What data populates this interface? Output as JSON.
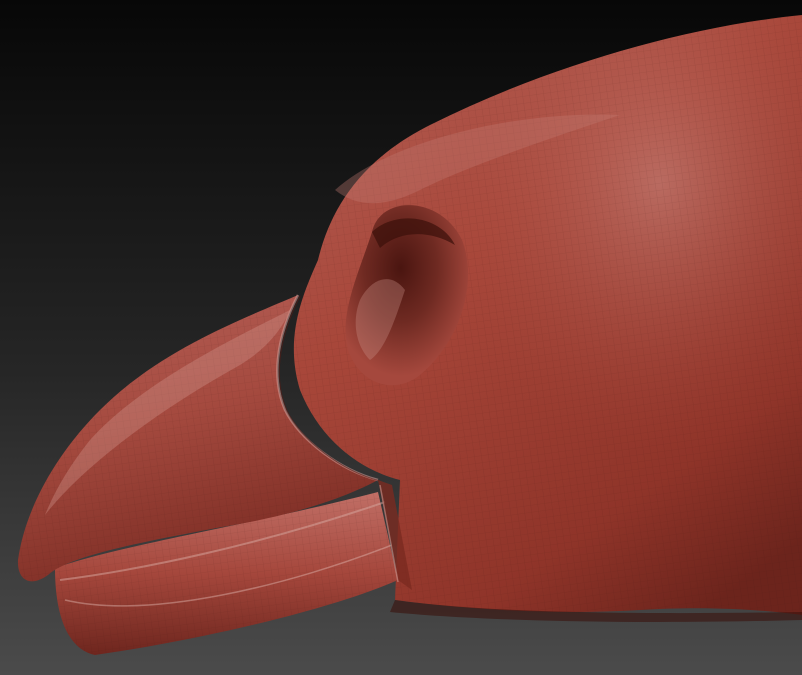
{
  "viewport": {
    "subject": "sculpted-bird-head-icon",
    "material_color": "#a8473a",
    "material_highlight": "#c98f88",
    "material_shadow": "#5a1d16",
    "background_top": "#070707",
    "background_bottom": "#4b4b4b"
  }
}
